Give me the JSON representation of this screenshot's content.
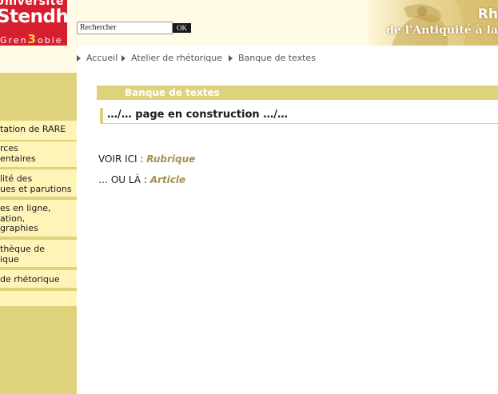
{
  "logo": {
    "line1": "Université",
    "line2": "Stendhal",
    "line3_prefix": "Gren",
    "line3_number": "3",
    "line3_suffix": "oble"
  },
  "search": {
    "placeholder": "Rechercher",
    "value": "Rechercher",
    "ok_label": "OK"
  },
  "banner": {
    "title": "Rh",
    "subtitle": "de l'Antiquité à la"
  },
  "breadcrumb": {
    "items": [
      "Accueil",
      "Atelier de rhétorique",
      "Banque de textes"
    ]
  },
  "sidebar": {
    "items": [
      {
        "lines": [
          "tation de RARE"
        ]
      },
      {
        "lines": [
          "rces",
          "entaires"
        ]
      },
      {
        "lines": [
          "lité des",
          "ues et parutions"
        ]
      },
      {
        "lines": [
          "es en ligne,",
          "ation,",
          "graphies"
        ]
      },
      {
        "lines": [
          "thèque de",
          "ique"
        ]
      },
      {
        "lines": [
          "de rhétorique"
        ]
      }
    ]
  },
  "main": {
    "section_title": "Banque de textes",
    "page_heading": "…/… page en construction …/…",
    "voir_ici_label": "VOIR ICI : ",
    "voir_ici_link": "Rubrique",
    "ou_la_label": "… OU LÀ : ",
    "ou_la_link": "Article"
  },
  "colors": {
    "brand_red": "#d51f2e",
    "sidebar_gold": "#ded27d",
    "nav_item_bg": "#fff4b8",
    "link_gold": "#a49252"
  }
}
